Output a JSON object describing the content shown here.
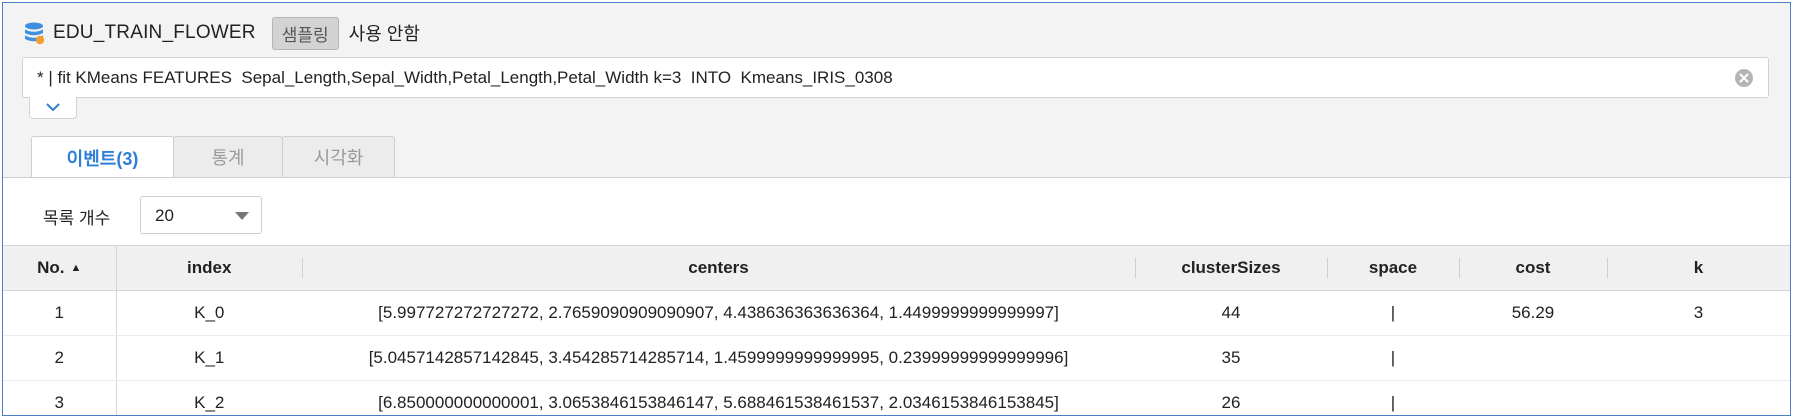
{
  "header": {
    "dataset_name": "EDU_TRAIN_FLOWER",
    "sample_button": "샘플링",
    "sample_status": "사용 안함"
  },
  "query": {
    "text": "* | fit KMeans FEATURES  Sepal_Length,Sepal_Width,Petal_Length,Petal_Width k=3  INTO  Kmeans_IRIS_0308"
  },
  "tabs": [
    {
      "label": "이벤트(3)",
      "active": true
    },
    {
      "label": "통계",
      "active": false
    },
    {
      "label": "시각화",
      "active": false
    }
  ],
  "controls": {
    "rows_label": "목록 개수",
    "rows_value": "20"
  },
  "table": {
    "columns": [
      "No.",
      "index",
      "centers",
      "clusterSizes",
      "space",
      "cost",
      "k"
    ],
    "sort_column": "No.",
    "rows": [
      {
        "no": "1",
        "index": "K_0",
        "centers": "[5.997727272727272, 2.7659090909090907, 4.438636363636364, 1.4499999999999997]",
        "clusterSizes": "44",
        "space": "|",
        "cost": "56.29",
        "k": "3"
      },
      {
        "no": "2",
        "index": "K_1",
        "centers": "[5.0457142857142845, 3.454285714285714, 1.4599999999999995, 0.23999999999999996]",
        "clusterSizes": "35",
        "space": "|",
        "cost": "",
        "k": ""
      },
      {
        "no": "3",
        "index": "K_2",
        "centers": "[6.850000000000001, 3.0653846153846147, 5.688461538461537, 2.0346153846153845]",
        "clusterSizes": "26",
        "space": "|",
        "cost": "",
        "k": ""
      }
    ]
  },
  "colors": {
    "accent": "#2f7fd6",
    "frame_border": "#4a7fc7"
  },
  "icons": [
    "database-icon",
    "clear-icon",
    "chevron-down-icon",
    "sort-asc-icon",
    "dropdown-caret-icon"
  ]
}
